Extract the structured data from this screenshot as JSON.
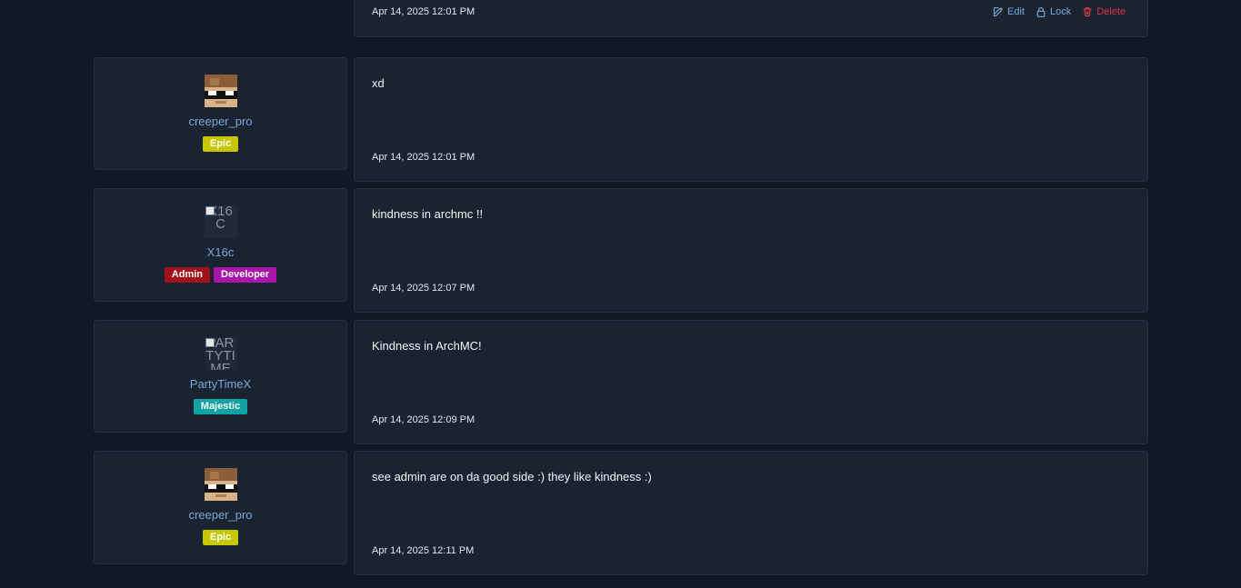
{
  "top_post": {
    "date": "Apr 14, 2025 12:01 PM",
    "actions": {
      "edit": "Edit",
      "lock": "Lock",
      "delete": "Delete"
    }
  },
  "posts": [
    {
      "username": "creeper_pro",
      "avatar": "skin",
      "badges": [
        {
          "label": "Epic",
          "color": "#c7c700"
        }
      ],
      "text": "xd",
      "date": "Apr 14, 2025 12:01 PM"
    },
    {
      "username": "X16c",
      "avatar_alt": "X16C",
      "badges": [
        {
          "label": "Admin",
          "color": "#a1111b"
        },
        {
          "label": "Developer",
          "color": "#a815a8"
        }
      ],
      "text": "kindness in archmc !!",
      "date": "Apr 14, 2025 12:07 PM"
    },
    {
      "username": "PartyTimeX",
      "avatar_alt": "PARTYTIME",
      "badges": [
        {
          "label": "Majestic",
          "color": "#0fa3a3"
        }
      ],
      "text": "Kindness in ArchMC!",
      "date": "Apr 14, 2025 12:09 PM"
    },
    {
      "username": "creeper_pro",
      "avatar": "skin",
      "badges": [
        {
          "label": "Epic",
          "color": "#c7c700"
        }
      ],
      "text": "see admin are on da good side :) they like kindness :)",
      "date": "Apr 14, 2025 12:11 PM"
    }
  ]
}
